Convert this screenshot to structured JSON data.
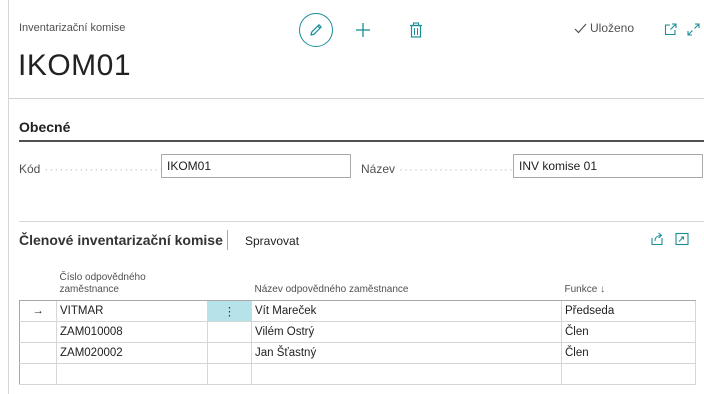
{
  "header": {
    "caption": "Inventarizační komise",
    "title": "IKOM01",
    "saved_label": "Uloženo",
    "icons": [
      "edit-icon",
      "add-icon",
      "delete-icon",
      "checkmark-icon",
      "open-new-window-icon",
      "expand-icon"
    ]
  },
  "general": {
    "section_title": "Obecné",
    "code_label": "Kód",
    "code_value": "IKOM01",
    "name_label": "Název",
    "name_value": "INV komise 01"
  },
  "members": {
    "part_title": "Členové inventarizační komise",
    "manage_label": "Spravovat",
    "columns": {
      "employee_no": "Číslo odpovědného zaměstnance",
      "employee_name": "Název odpovědného zaměstnance",
      "function": "Funkce ↓"
    },
    "rows": [
      {
        "marker": "→",
        "employee_no": "VITMAR",
        "dots": "⋮",
        "employee_name": "Vít Mareček",
        "function": "Předseda"
      },
      {
        "marker": "",
        "employee_no": "ZAM010008",
        "dots": "",
        "employee_name": "Vilém Ostrý",
        "function": "Člen"
      },
      {
        "marker": "",
        "employee_no": "ZAM020002",
        "dots": "",
        "employee_name": "Jan Šťastný",
        "function": "Člen"
      },
      {
        "marker": "",
        "employee_no": "",
        "dots": "",
        "employee_name": "",
        "function": ""
      }
    ]
  },
  "colors": {
    "accent": "#1a8e97",
    "selected_cell": "#b6e3e9"
  }
}
